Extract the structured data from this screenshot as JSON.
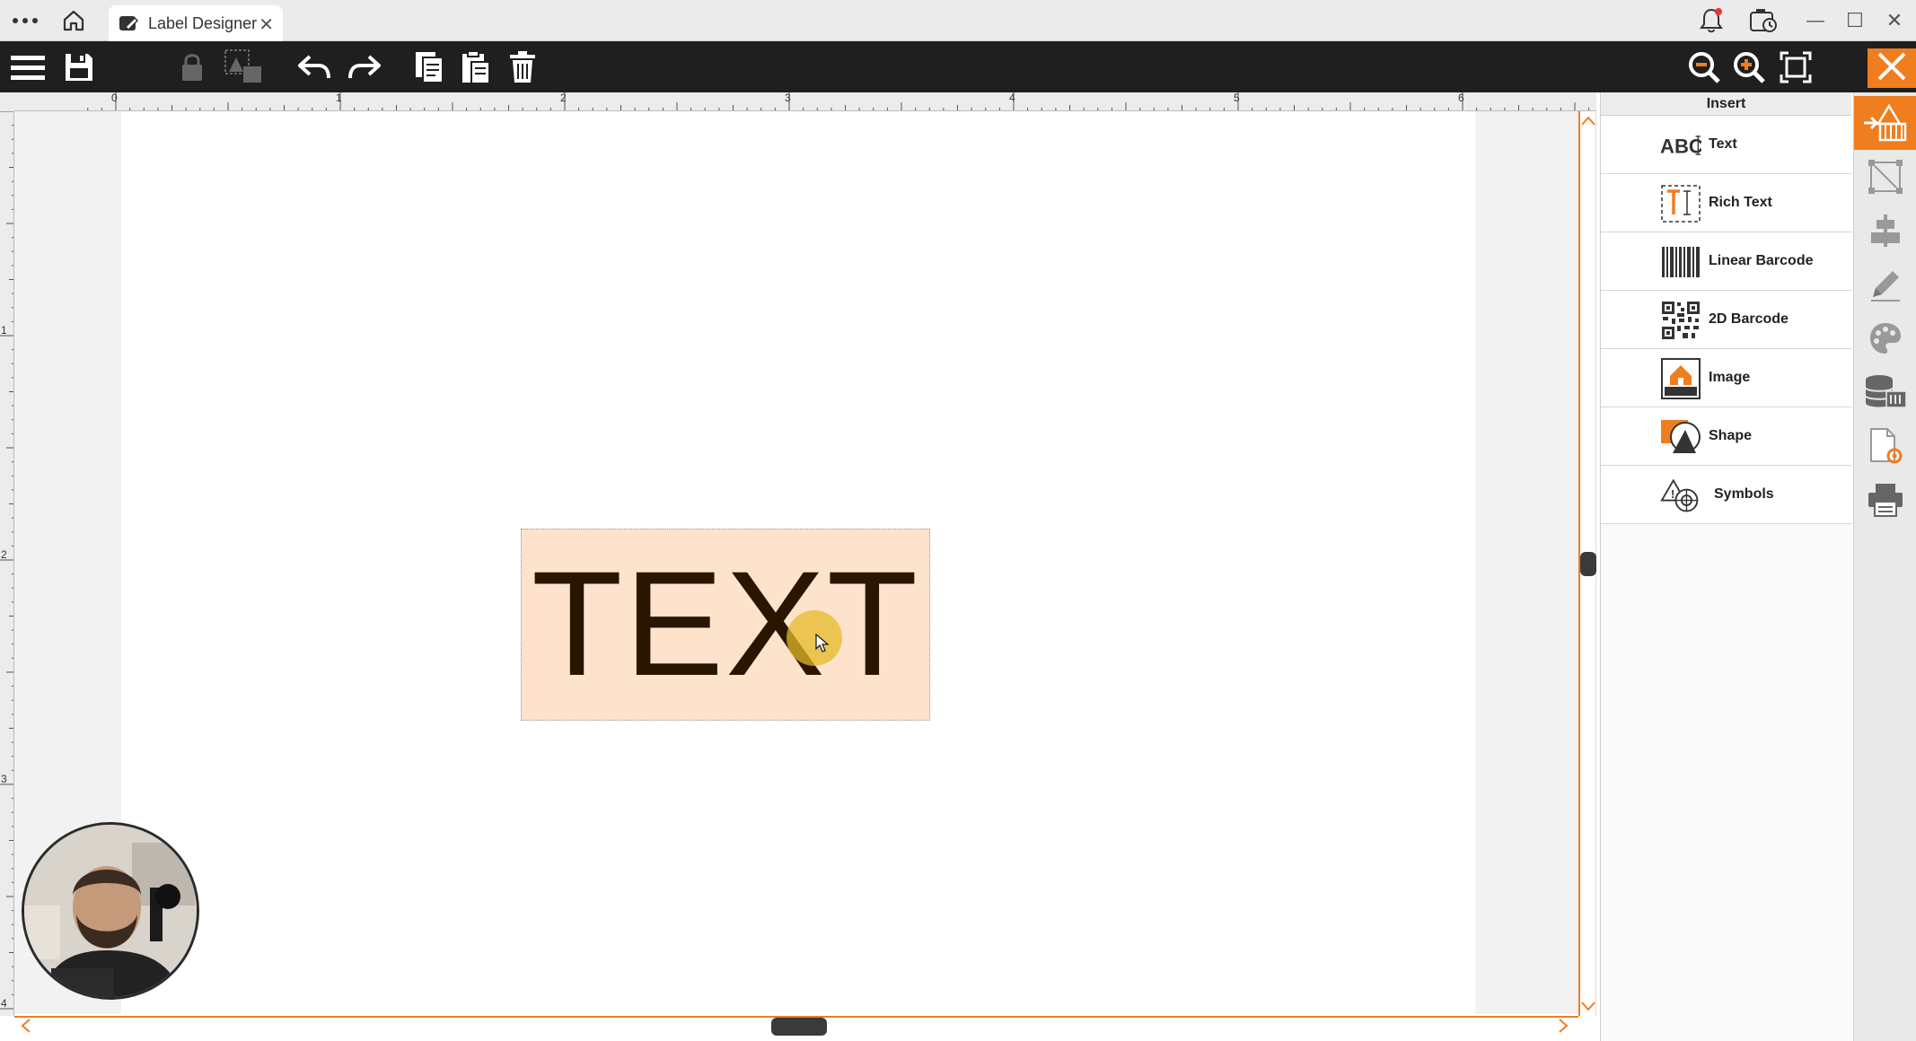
{
  "titlebar": {
    "tab_title": "Label Designer",
    "tab_close": "✕",
    "window_minimize": "—",
    "window_maximize": "☐",
    "window_close": "✕"
  },
  "toolbar": {
    "icons": [
      "menu-icon",
      "save-icon",
      "lock-icon",
      "group-icon",
      "undo-icon",
      "redo-icon",
      "copy-icon",
      "paste-icon",
      "delete-icon",
      "zoom-out-icon",
      "zoom-in-icon",
      "fit-page-icon",
      "close-icon"
    ]
  },
  "ruler": {
    "horizontal": [
      "0",
      "1",
      "2",
      "3",
      "4",
      "5",
      "6"
    ],
    "vertical": [
      "1",
      "2",
      "3",
      "4"
    ]
  },
  "canvas": {
    "text_object": "TEXT"
  },
  "insert_panel": {
    "header": "Insert",
    "items": [
      {
        "label": "Text",
        "icon": "abc-text-icon"
      },
      {
        "label": "Rich Text",
        "icon": "rich-text-icon"
      },
      {
        "label": "Linear Barcode",
        "icon": "linear-barcode-icon"
      },
      {
        "label": "2D Barcode",
        "icon": "qr-code-icon"
      },
      {
        "label": "Image",
        "icon": "image-icon"
      },
      {
        "label": "Shape",
        "icon": "shape-icon"
      },
      {
        "label": "Symbols",
        "icon": "symbols-icon"
      }
    ]
  },
  "side_strip": {
    "icons": [
      "insert-icon",
      "object-properties-icon",
      "align-icon",
      "edit-pencil-icon",
      "palette-icon",
      "database-icon",
      "document-settings-icon",
      "print-icon"
    ]
  },
  "colors": {
    "accent": "#f07d1e",
    "toolbar_bg": "#1f1f1f",
    "text_object_bg": "#fde3cc",
    "text_object_fg": "#2a1500"
  }
}
